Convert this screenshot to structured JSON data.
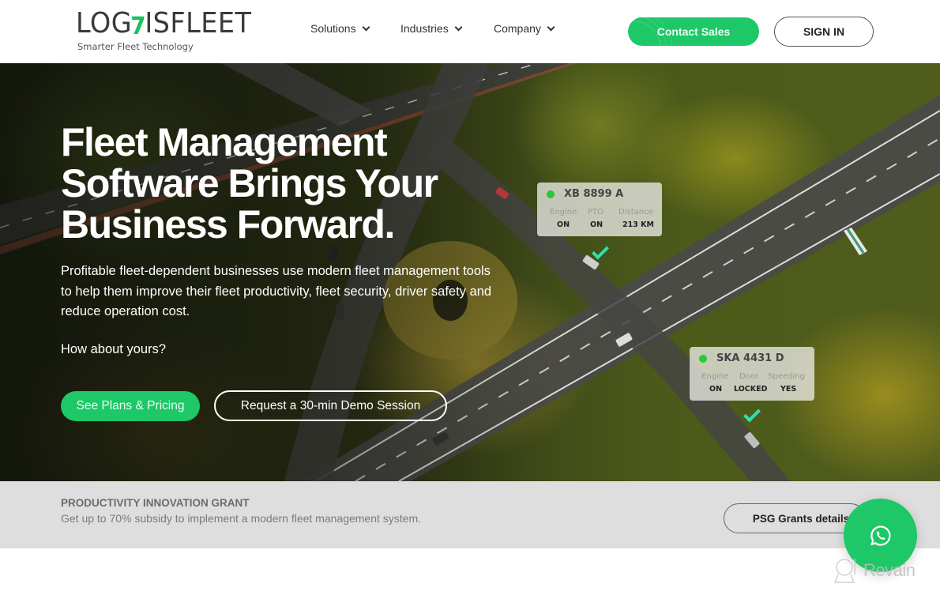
{
  "header": {
    "logo": {
      "text_before": "LOG",
      "accent_glyph": "7",
      "text_after": "ISFLEET",
      "tagline": "Smarter Fleet Technology"
    },
    "nav": [
      {
        "label": "Solutions",
        "icon": "chevron-down-icon"
      },
      {
        "label": "Industries",
        "icon": "chevron-down-icon"
      },
      {
        "label": "Company",
        "icon": "chevron-down-icon"
      }
    ],
    "contact_label": "Contact Sales",
    "signin_label": "SIGN IN"
  },
  "hero": {
    "title_lines": [
      "Fleet Management",
      "Software Brings Your",
      "Business Forward."
    ],
    "description": "Profitable fleet-dependent businesses use modern fleet management tools to help them improve their fleet productivity, fleet security, driver safety and reduce operation cost.",
    "question": "How about yours?",
    "primary_cta": "See Plans & Pricing",
    "secondary_cta": "Request a 30-min Demo Session",
    "vehicle_cards": [
      {
        "plate": "XB 8899 A",
        "status_color": "#22cc33",
        "fields": [
          {
            "label": "Engine",
            "value": "ON"
          },
          {
            "label": "PTO",
            "value": "ON"
          },
          {
            "label": "Distance",
            "value": "213 KM"
          }
        ]
      },
      {
        "plate": "SKA 4431 D",
        "status_color": "#22cc33",
        "fields": [
          {
            "label": "Engine",
            "value": "ON"
          },
          {
            "label": "Door",
            "value": "LOCKED"
          },
          {
            "label": "Speeding",
            "value": "YES"
          }
        ]
      }
    ]
  },
  "grant": {
    "title": "PRODUCTIVITY INNOVATION GRANT",
    "description": "Get up to 70% subsidy to implement a modern fleet management system.",
    "button_label": "PSG Grants details"
  },
  "floating": {
    "whatsapp_icon": "whatsapp-icon"
  },
  "watermark": {
    "text": "Revain"
  },
  "colors": {
    "brand_green": "#1ec767",
    "status_green": "#22cc33",
    "check_teal": "#2fe0b0",
    "grant_bg": "#dedede"
  }
}
